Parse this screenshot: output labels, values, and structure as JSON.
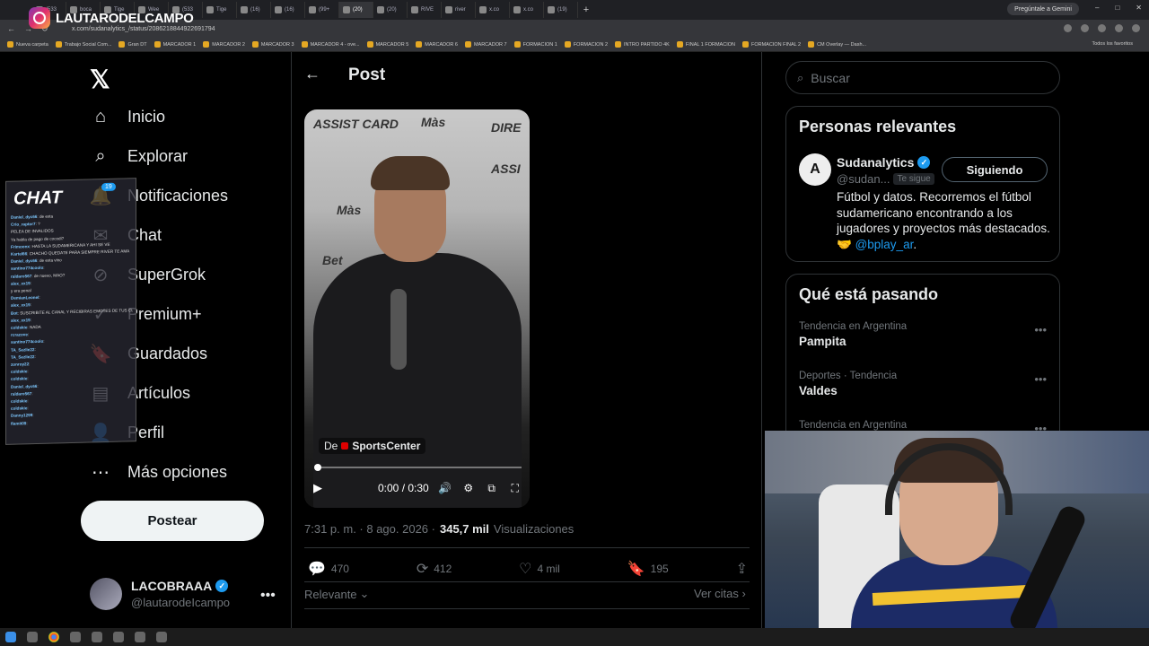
{
  "browser": {
    "tabs": [
      "(533",
      "boca",
      "Tige",
      "Wee",
      "(533",
      "Tige",
      "(16)",
      "(16)",
      "(99+",
      "(20)",
      "(20)",
      "RIVE",
      "river",
      "x.co",
      "x.co",
      "(19)"
    ],
    "gemini_label": "Pregúntale a Gemini",
    "url": "x.com/sudanalytics_/status/2086218844922691794",
    "bookmarks": [
      "Nueva carpeta",
      "Trabajo Social Com...",
      "Gran DT",
      "MARCADOR 1",
      "MARCADOR 2",
      "MARCADOR 3",
      "MARCADOR 4 - ove...",
      "MARCADOR 5",
      "MARCADOR 6",
      "MARCADOR 7",
      "FORMACION 1",
      "FORMACION 2",
      "INTRO PARTIDO 4K",
      "FINAL 1 FORMACION",
      "FORMACION FINAL 2",
      "CM Overlay — Dash..."
    ],
    "bookmarks_right": "Todos los favoritos"
  },
  "overlay": {
    "brand_name": "LAUTARODELCAMPO",
    "chat_title": "CHAT",
    "chat_badge": "19",
    "chat_lines": [
      [
        "Daniel_dyc66",
        "de esta"
      ],
      [
        "Crio_raptor7",
        "?"
      ],
      [
        "",
        "PELEA DE INVALIDOS"
      ],
      [
        "",
        "Ya habla de pago de cocodi?"
      ],
      [
        "Frimoonx",
        "HASTA LA SUDAMERICANA Y AHI SE VE"
      ],
      [
        "Kartel66",
        "CHACHO QUEDATE PARA SIEMPRE RIVER TE AMA"
      ],
      [
        "Daniel_dyc66",
        "de esta vino"
      ],
      [
        "santino774coolo",
        ""
      ],
      [
        "raldaro567",
        "de nuevo, MAO?"
      ],
      [
        "alex_xx19",
        ""
      ],
      [
        "",
        "y era penal"
      ],
      [
        "DemianLeonel",
        ""
      ],
      [
        "alex_xx19",
        ""
      ],
      [
        "Bot",
        "SUSCRIBITE AL CANAL Y RECIBIRAS EMOTES DE TUS CLUBES FAVORITOS!"
      ],
      [
        "alex_xx19",
        ""
      ],
      [
        "coldskie",
        "NADA"
      ],
      [
        "rcrazove",
        ""
      ],
      [
        "santino774coolo",
        ""
      ],
      [
        "TA_Sezlie22",
        ""
      ],
      [
        "TA_Sezlie22",
        ""
      ],
      [
        "zonroy22",
        ""
      ],
      [
        "coldskie",
        ""
      ],
      [
        "coldskie",
        ""
      ],
      [
        "Daniel_dyc66",
        ""
      ],
      [
        "raldaro567",
        ""
      ],
      [
        "coldskie",
        ""
      ],
      [
        "coldskie",
        ""
      ],
      [
        "Danny1299",
        ""
      ],
      [
        "flamit09",
        ""
      ]
    ]
  },
  "nav": {
    "items": [
      {
        "label": "Inicio",
        "icon": "home-icon"
      },
      {
        "label": "Explorar",
        "icon": "search-icon"
      },
      {
        "label": "Notificaciones",
        "icon": "bell-icon"
      },
      {
        "label": "Chat",
        "icon": "chat-icon"
      },
      {
        "label": "SuperGrok",
        "icon": "grok-icon"
      },
      {
        "label": "Premium+",
        "icon": "premium-icon"
      },
      {
        "label": "Guardados",
        "icon": "bookmark-icon"
      },
      {
        "label": "Artículos",
        "icon": "article-icon"
      },
      {
        "label": "Perfil",
        "icon": "person-icon"
      },
      {
        "label": "Más opciones",
        "icon": "more-circle-icon"
      }
    ],
    "post_button": "Postear",
    "profile_name": "LACOBRAAA",
    "profile_handle": "@lautarodeIcampo"
  },
  "post": {
    "header_title": "Post",
    "video": {
      "source_prefix": "De",
      "source_name": "SportsCenter",
      "time": "0:00 / 0:30",
      "progress": 0.0,
      "sponsors": [
        "ASSIST CARD",
        "Màs",
        "DIRE",
        "ASSI",
        "Màs",
        "Bet"
      ]
    },
    "timestamp": "7:31 p. m. · 8 ago. 2026 ·",
    "views_count": "345,7 mil",
    "views_label": "Visualizaciones",
    "actions": {
      "replies": "470",
      "reposts": "412",
      "likes": "4 mil",
      "bookmarks": "195"
    },
    "relevante_label": "Relevante",
    "ver_citas_label": "Ver citas"
  },
  "right": {
    "search_placeholder": "Buscar",
    "relevant_title": "Personas relevantes",
    "person": {
      "name": "Sudanalytics",
      "handle": "@sudan...",
      "follows_you": "Te sigue",
      "follow_button": "Siguiendo",
      "bio": "Fútbol y datos. Recorremos el fútbol sudamericano encontrando a los jugadores y proyectos más destacados. 🤝",
      "bio_mention": "@bplay_ar",
      "bio_end": "."
    },
    "trends_title": "Qué está pasando",
    "trends": [
      {
        "meta": "Tendencia en Argentina",
        "name": "Pampita"
      },
      {
        "meta": "Deportes · Tendencia",
        "name": "Valdes"
      },
      {
        "meta": "Tendencia en Argentina",
        "name": ""
      }
    ]
  }
}
